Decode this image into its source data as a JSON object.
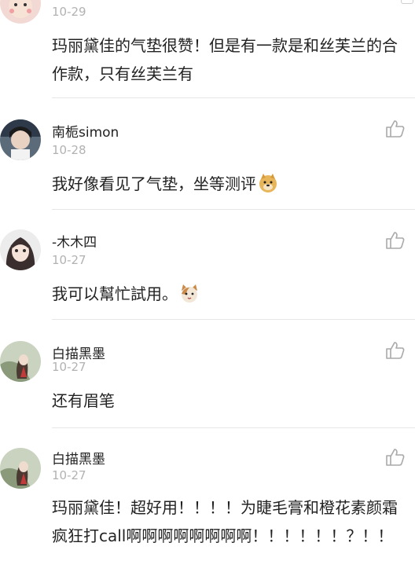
{
  "comments": [
    {
      "name": "",
      "date": "10-29",
      "text": "玛丽黛佳的气垫很赞！但是有一款是和丝芙兰的合作款，只有丝芙兰有",
      "emoji": ""
    },
    {
      "name": "南栀simon",
      "date": "10-28",
      "text": "我好像看见了气垫，坐等测评",
      "emoji": "doge-emoji"
    },
    {
      "name": "-木木四",
      "date": "10-27",
      "text": "我可以幫忙試用。",
      "emoji": "cat-emoji"
    },
    {
      "name": "白描黑墨",
      "date": "10-27",
      "text": "还有眉笔",
      "emoji": ""
    },
    {
      "name": "白描黑墨",
      "date": "10-27",
      "text": "玛丽黛佳！超好用！！！！为睫毛膏和橙花素颜霜疯狂打call啊啊啊啊啊啊啊啊！！！！！！？！！",
      "emoji": ""
    }
  ],
  "icons": {
    "like": "thumbs-up-icon"
  },
  "colors": {
    "divider": "#e6e6e6",
    "date": "#b2b2b2",
    "text": "#222222"
  }
}
